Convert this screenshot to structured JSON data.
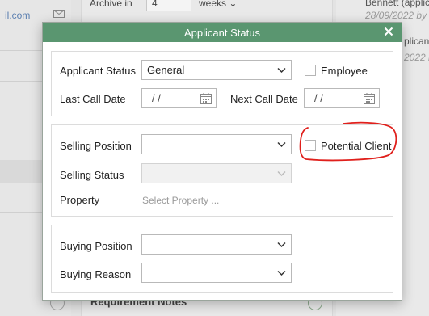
{
  "background": {
    "email_fragment": "il.com",
    "archive_label": "Archive in",
    "archive_value": "4",
    "archive_unit": "weeks",
    "requirement_notes": "Requirement Notes",
    "right_list": [
      {
        "name": "Bennett (applic",
        "date": "28/09/2022 by"
      },
      {
        "name": "plicant",
        "date": "2022 by"
      }
    ]
  },
  "dialog": {
    "title": "Applicant Status",
    "applicant_status": {
      "label": "Applicant Status",
      "value": "General",
      "employee_label": "Employee",
      "employee_checked": false
    },
    "last_call": {
      "label": "Last Call Date",
      "value": "/ /"
    },
    "next_call": {
      "label": "Next Call Date",
      "value": "/ /"
    },
    "selling": {
      "position_label": "Selling Position",
      "position_value": "",
      "potential_client_label": "Potential Client",
      "potential_client_checked": false,
      "status_label": "Selling Status",
      "status_value": "",
      "property_label": "Property",
      "property_placeholder": "Select Property ..."
    },
    "buying": {
      "position_label": "Buying Position",
      "position_value": "",
      "reason_label": "Buying Reason",
      "reason_value": ""
    }
  },
  "colors": {
    "titlebar": "#5a9670",
    "annotation": "#e0201c"
  }
}
